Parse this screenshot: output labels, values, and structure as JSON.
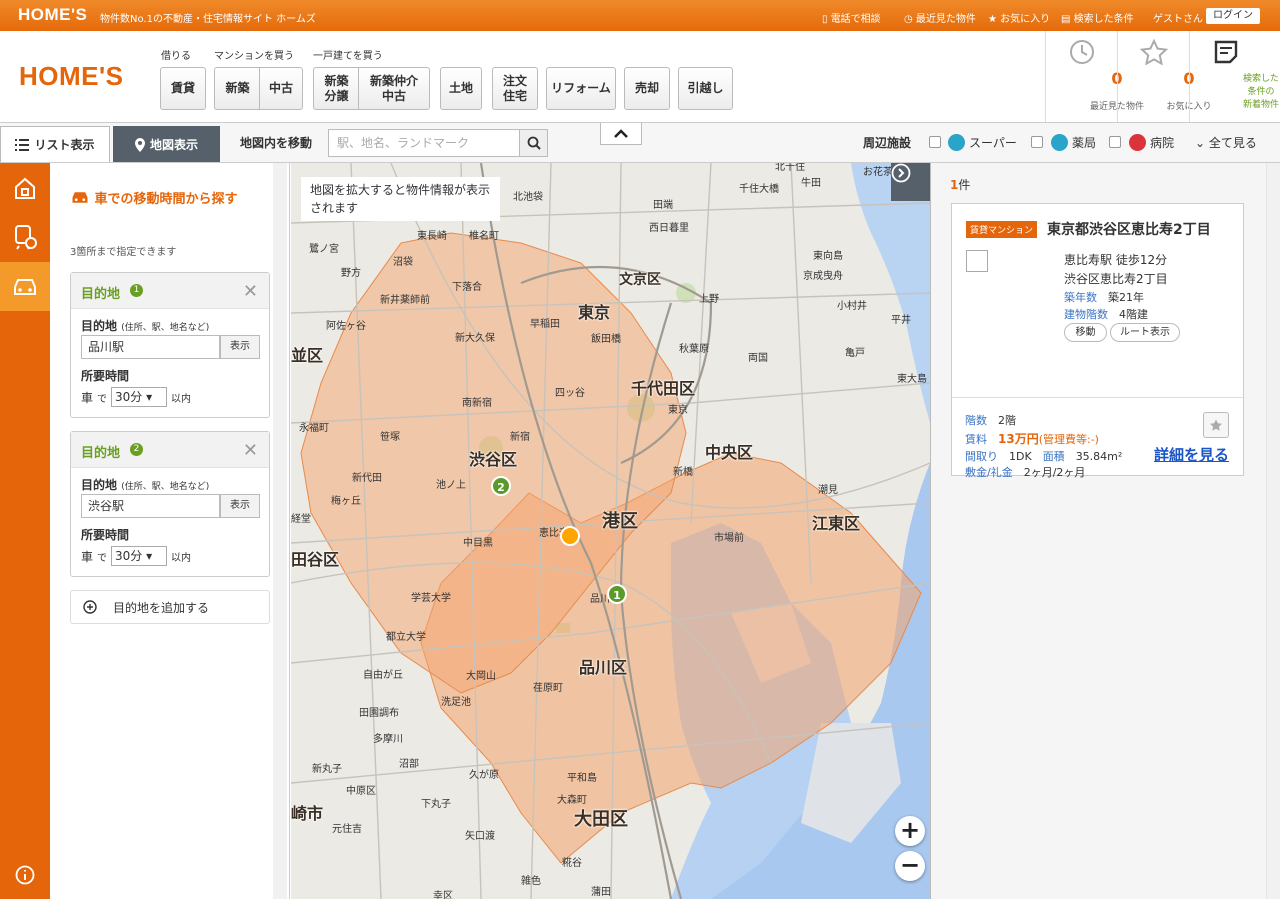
{
  "topbar": {
    "logo": "HOME'S",
    "tagline": "物件数No.1の不動産・住宅情報サイト ホームズ",
    "links": [
      "電話で相談",
      "最近見た物件",
      "お気に入り",
      "検索した条件"
    ],
    "guest": "ゲストさん",
    "login": "ログイン"
  },
  "header": {
    "logo": "HOME'S",
    "categories": [
      "借りる",
      "マンションを買う",
      "一戸建てを買う"
    ],
    "buttons": [
      "賃貸",
      "新築",
      "中古",
      "新築\n分譲",
      "新築仲介\n中古",
      "土地",
      "注文\n住宅",
      "リフォーム",
      "売却",
      "引越し"
    ],
    "stats": [
      {
        "count": "0",
        "label": "最近見た物件"
      },
      {
        "count": "0",
        "label": "お気に入り"
      }
    ],
    "new_listings_label": "検索した\n条件の\n新着物件"
  },
  "toolbar": {
    "list_tab": "リスト表示",
    "map_tab": "地図表示",
    "move_label": "地図内を移動",
    "search_placeholder": "駅、地名、ランドマーク",
    "facilities_label": "周辺施設",
    "facilities": [
      "スーパー",
      "薬局",
      "病院"
    ],
    "see_all": "全て見る"
  },
  "panel": {
    "title": "車での移動時間から探す",
    "note": "3箇所まで指定できます",
    "destinations": [
      {
        "label": "目的地",
        "num": "1",
        "field_label": "目的地",
        "field_hint": "(住所、駅、地名など)",
        "value": "品川駅",
        "show_btn": "表示",
        "time_label": "所要時間",
        "mode": "車",
        "de": "で",
        "minutes": "30分",
        "within": "以内"
      },
      {
        "label": "目的地",
        "num": "2",
        "field_label": "目的地",
        "field_hint": "(住所、駅、地名など)",
        "value": "渋谷駅",
        "show_btn": "表示",
        "time_label": "所要時間",
        "mode": "車",
        "de": "で",
        "minutes": "30分",
        "within": "以内"
      }
    ],
    "add_label": "目的地を追加する"
  },
  "map": {
    "hint": "地図を拡大すると物件情報が表示されます",
    "wards": [
      "東京",
      "文京区",
      "千代田区",
      "渋谷区",
      "中央区",
      "港区",
      "江東区",
      "品川区",
      "大田区",
      "田谷区",
      "並区",
      "崎市"
    ],
    "places": [
      "北池袋",
      "北千住",
      "千住大橋",
      "牛田",
      "お花茶",
      "田端",
      "西日暮里",
      "東長崎",
      "椎名町",
      "鷺ノ宮",
      "沼袋",
      "東向島",
      "京成曳舟",
      "野方",
      "下落合",
      "上野",
      "小村井",
      "平井",
      "新井薬師前",
      "早稲田",
      "阿佐ヶ谷",
      "新大久保",
      "飯田橋",
      "秋葉原",
      "両国",
      "亀戸",
      "四ッ谷",
      "東大島",
      "南新宿",
      "東京",
      "永福町",
      "笹塚",
      "新宿",
      "新代田",
      "池ノ上",
      "梅ヶ丘",
      "潮見",
      "経堂",
      "中目黒",
      "恵比寿",
      "市場前",
      "学芸大学",
      "品川",
      "都立大学",
      "自由が丘",
      "大岡山",
      "荏原町",
      "洗足池",
      "田園調布",
      "多摩川",
      "新丸子",
      "沼部",
      "久が原",
      "平和島",
      "中原区",
      "下丸子",
      "大森町",
      "元住吉",
      "矢口渡",
      "糀谷",
      "雑色",
      "幸区",
      "新橋",
      "蒲田"
    ],
    "pins": [
      "1",
      "2"
    ]
  },
  "results": {
    "count": "1",
    "count_suffix": "件",
    "card": {
      "badge": "賃貸マンション",
      "title": "東京都渋谷区恵比寿2丁目",
      "station": "恵比寿駅 徒歩12分",
      "address": "渋谷区恵比寿2丁目",
      "age_key": "築年数",
      "age": "築21年",
      "floors_key": "建物階数",
      "floors": "4階建",
      "move_btn": "移動",
      "route_btn": "ルート表示",
      "floor_key": "階数",
      "floor": "2階",
      "rent_key": "賃料",
      "rent": "13万円",
      "mgmt": "(管理費等:-)",
      "layout_key": "間取り",
      "layout": "1DK",
      "area_key": "面積",
      "area": "35.84m²",
      "deposit_key": "敷金/礼金",
      "deposit": "2ヶ月/2ヶ月",
      "detail_link": "詳細を見る"
    }
  },
  "colors": {
    "brand_orange": "#e5650a",
    "isochrone": "#f4a46d",
    "pin_green": "#5a9a2a",
    "marker": "#ffa500"
  }
}
